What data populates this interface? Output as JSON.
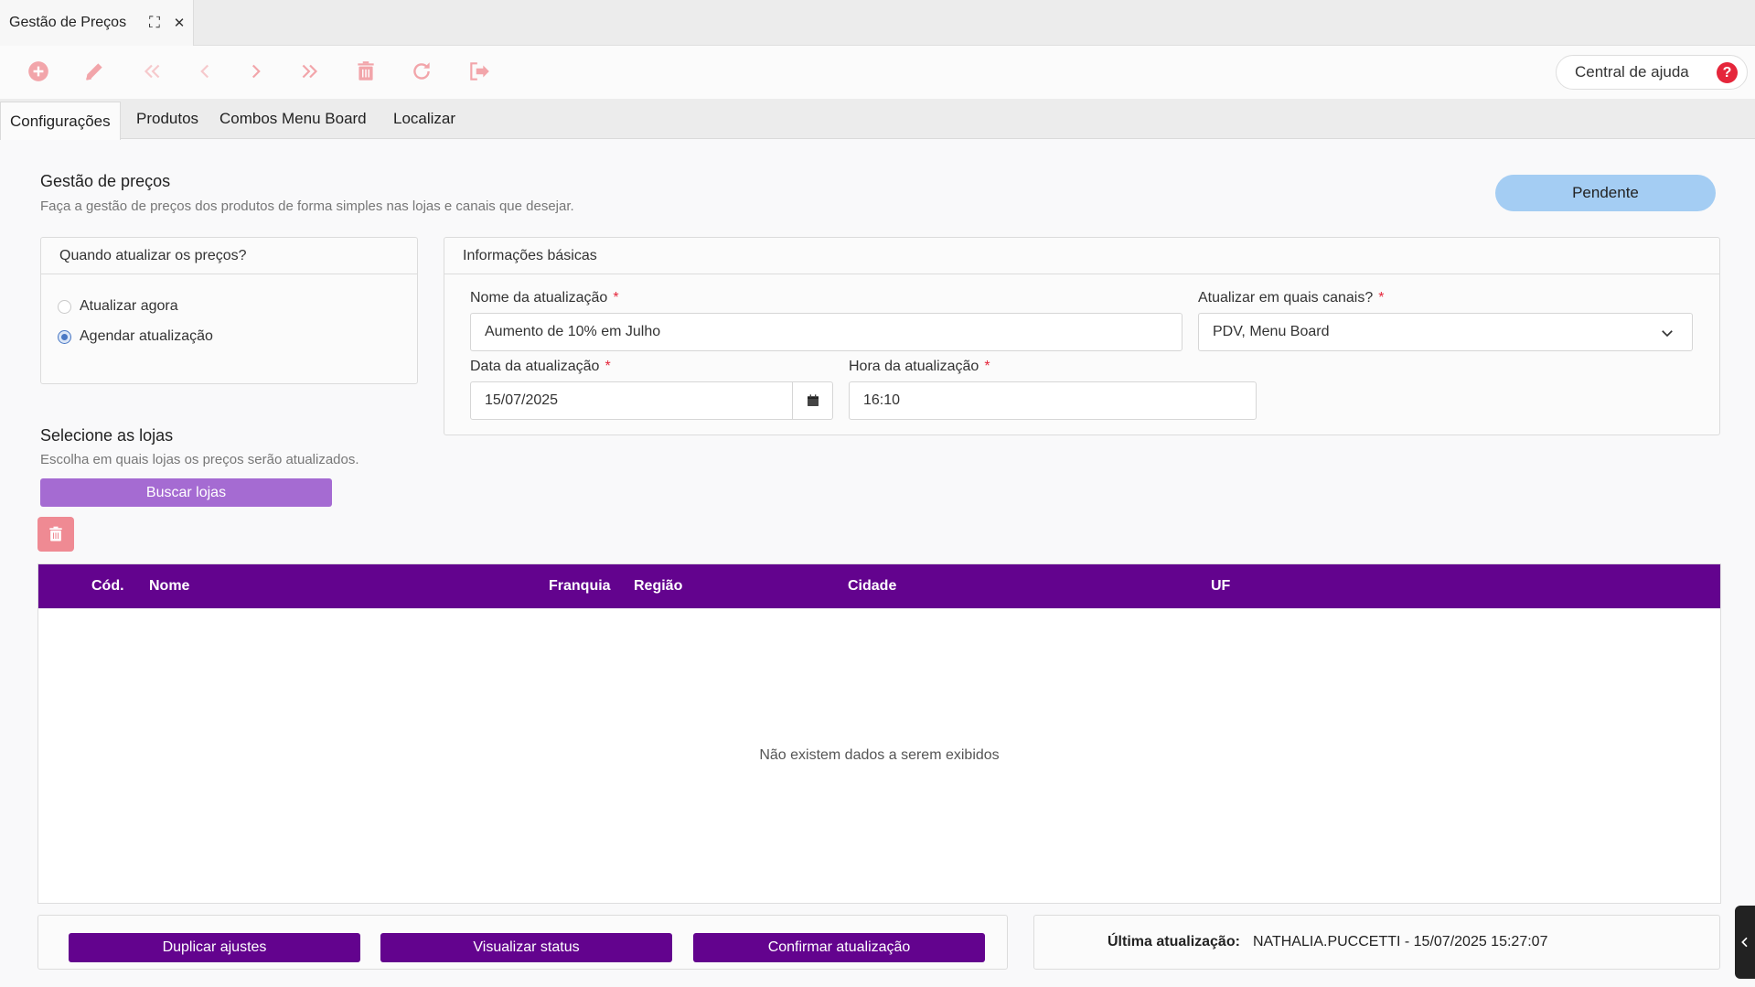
{
  "window": {
    "tab_title": "Gestão de Preços",
    "expand_symbol": "⛶",
    "close_symbol": "✕"
  },
  "toolbar": {
    "icons": [
      "add-circle-icon",
      "pencil-icon",
      "first-page-icon",
      "previous-icon",
      "next-icon",
      "last-page-icon",
      "trash-icon",
      "refresh-icon",
      "logout-icon"
    ],
    "icon_color": "#f2a5aa",
    "help_label": "Central de ajuda",
    "help_symbol": "?"
  },
  "nav": {
    "tabs": [
      "Configurações",
      "Produtos",
      "Combos Menu Board",
      "Localizar"
    ],
    "active": "Configurações"
  },
  "header": {
    "title": "Gestão de preços",
    "subtitle": "Faça a gestão de preços dos produtos de forma simples nas lojas e canais que desejar.",
    "status": "Pendente"
  },
  "when_card": {
    "title": "Quando atualizar os preços?",
    "options": [
      {
        "label": "Atualizar agora",
        "checked": false
      },
      {
        "label": "Agendar atualização",
        "checked": true
      }
    ]
  },
  "basic_info": {
    "title": "Informações básicas",
    "name_label": "Nome da atualização",
    "name_value": "Aumento de 10% em Julho",
    "channels_label": "Atualizar em quais canais?",
    "channels_value": "PDV, Menu Board",
    "date_label": "Data da atualização",
    "date_value": "15/07/2025",
    "time_label": "Hora da atualização",
    "time_value": "16:10",
    "required_mark": "*"
  },
  "stores": {
    "title": "Selecione as lojas",
    "subtitle": "Escolha em quais lojas os preços serão atualizados.",
    "search_button": "Buscar lojas",
    "columns": [
      "Cód.",
      "Nome",
      "Franquia",
      "Região",
      "Cidade",
      "UF"
    ],
    "empty_message": "Não existem dados a serem exibidos"
  },
  "footer": {
    "buttons": [
      "Duplicar ajustes",
      "Visualizar status",
      "Confirmar atualização"
    ],
    "last_update_label": "Última atualização:",
    "last_update_value": "NATHALIA.PUCCETTI - 15/07/2025 15:27:07"
  },
  "colors": {
    "primary_purple": "#63038e",
    "light_purple": "#a56bd2",
    "status_blue": "#a4cdf3",
    "danger_red": "#e5263b"
  }
}
